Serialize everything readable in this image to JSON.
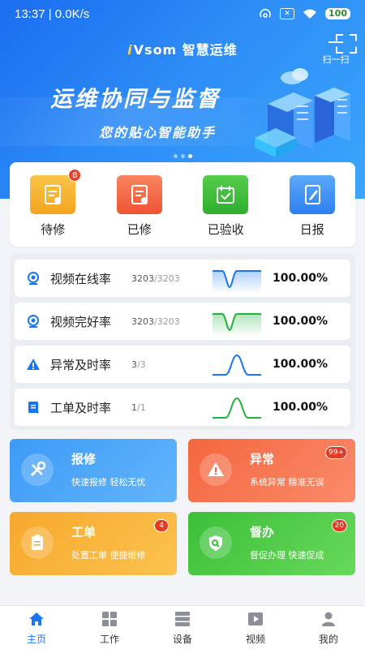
{
  "status_bar": {
    "time": "13:37",
    "speed": "0.0K/s",
    "battery": "100"
  },
  "header": {
    "brand_mark": "i",
    "brand_name": "Vsom 智慧运维",
    "scan_label": "扫一扫"
  },
  "banner": {
    "title": "运维协同与监督",
    "subtitle": "您的贴心智能助手"
  },
  "quick_actions": [
    {
      "label": "待修",
      "badge": "8",
      "color": "#f7b531",
      "icon": "pending-repair-icon"
    },
    {
      "label": "已修",
      "badge": "",
      "color": "#f4663e",
      "icon": "repaired-icon"
    },
    {
      "label": "已验收",
      "badge": "",
      "color": "#3cbd3c",
      "icon": "accepted-icon"
    },
    {
      "label": "日报",
      "badge": "",
      "color": "#3a8ff5",
      "icon": "daily-report-icon"
    }
  ],
  "stats": [
    {
      "name": "视频在线率",
      "num": "3203",
      "den": "/3203",
      "pct": "100.00%",
      "spark_color": "#1a76f0",
      "spark": "dip",
      "icon": "camera-online-icon"
    },
    {
      "name": "视频完好率",
      "num": "3203",
      "den": "/3203",
      "pct": "100.00%",
      "spark_color": "#22b33d",
      "spark": "dip",
      "icon": "camera-health-icon"
    },
    {
      "name": "异常及时率",
      "num": "3",
      "den": "/3",
      "pct": "100.00%",
      "spark_color": "#1a76f0",
      "spark": "peak",
      "icon": "alert-icon"
    },
    {
      "name": "工单及时率",
      "num": "1",
      "den": "/1",
      "pct": "100.00%",
      "spark_color": "#22b33d",
      "spark": "peak",
      "icon": "workorder-icon"
    }
  ],
  "cards": [
    {
      "title": "报修",
      "desc": "快速报修  轻松无忧",
      "badge": "",
      "color1": "#3c9bf7",
      "color2": "#63b4fb",
      "icon": "wrench-icon"
    },
    {
      "title": "异常",
      "desc": "系统异常  精准无误",
      "badge": "99+",
      "color1": "#f4663e",
      "color2": "#fa8b6a",
      "icon": "warning-icon"
    },
    {
      "title": "工单",
      "desc": "处置工单  便捷维修",
      "badge": "4",
      "color1": "#f7a82d",
      "color2": "#fcc24e",
      "icon": "clipboard-icon"
    },
    {
      "title": "督办",
      "desc": "督促办理  快速促成",
      "badge": "20",
      "color1": "#3cbf39",
      "color2": "#67d95a",
      "icon": "supervise-icon"
    }
  ],
  "tabs": [
    {
      "label": "主页",
      "icon": "home-icon",
      "active": true
    },
    {
      "label": "工作",
      "icon": "grid-icon",
      "active": false
    },
    {
      "label": "设备",
      "icon": "device-icon",
      "active": false
    },
    {
      "label": "视频",
      "icon": "video-icon",
      "active": false
    },
    {
      "label": "我的",
      "icon": "user-icon",
      "active": false
    }
  ]
}
